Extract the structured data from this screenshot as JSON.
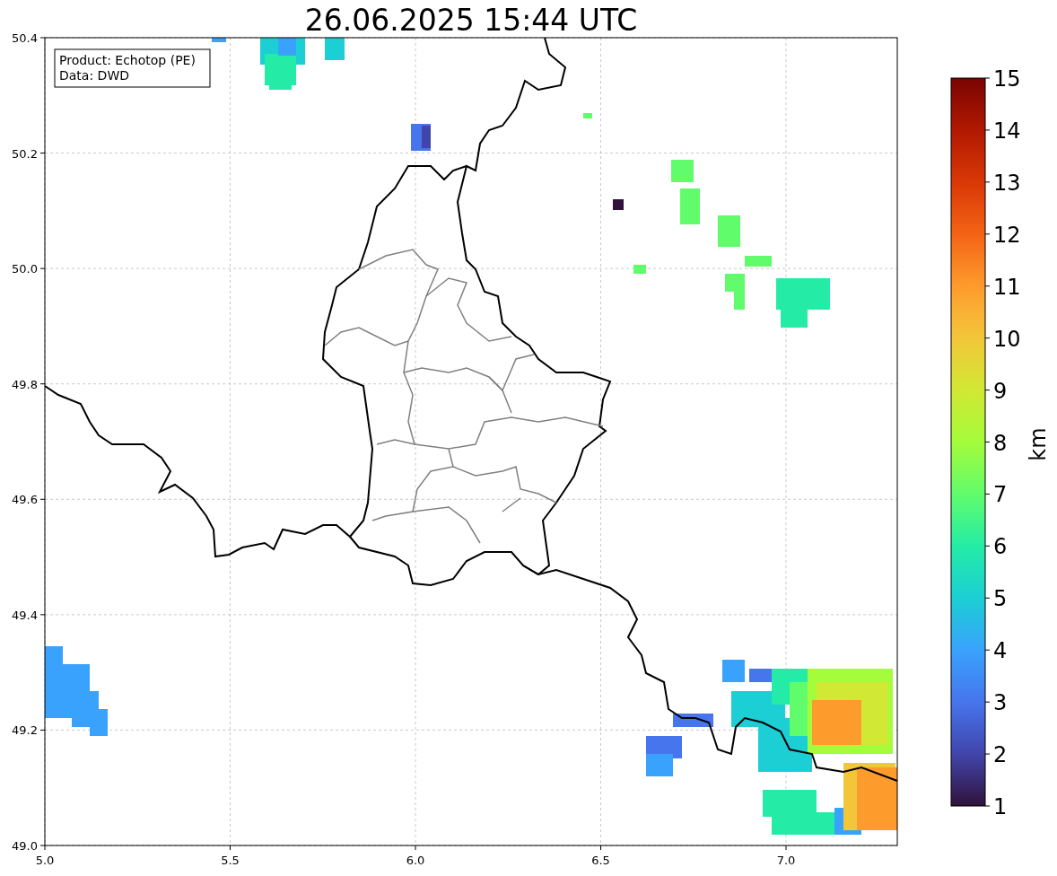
{
  "title": "26.06.2025 15:44 UTC",
  "info_box": [
    "Product: Echotop (PE)",
    "Data: DWD"
  ],
  "x_ticks": [
    "5.0",
    "5.5",
    "6.0",
    "6.5",
    "7.0"
  ],
  "y_ticks": [
    "50.4",
    "50.2",
    "50.0",
    "49.8",
    "49.6",
    "49.4",
    "49.2",
    "49.0"
  ],
  "colorbar": {
    "label": "km",
    "ticks": [
      "15",
      "14",
      "13",
      "12",
      "11",
      "10",
      "9",
      "8",
      "7",
      "6",
      "5",
      "4",
      "3",
      "2",
      "1"
    ]
  }
}
